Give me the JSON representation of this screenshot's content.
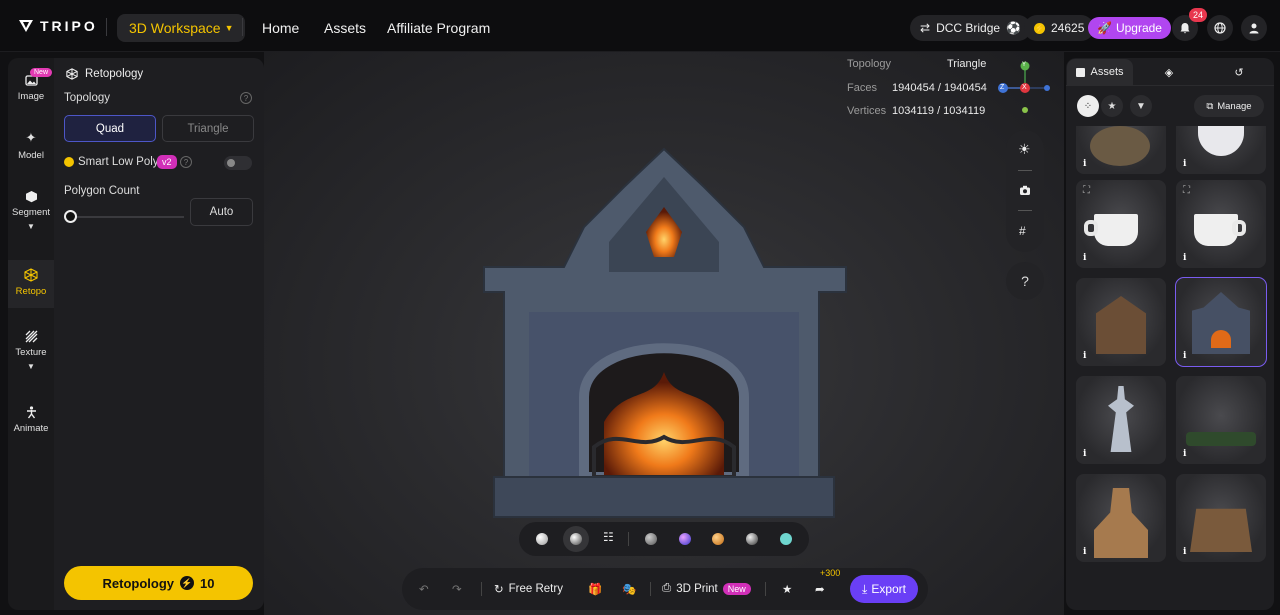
{
  "header": {
    "brand": "TRIPO",
    "workspace": "3D Workspace",
    "nav": [
      "Home",
      "Assets",
      "Affiliate Program"
    ],
    "dcc": "DCC Bridge",
    "credits": "24625",
    "upgrade": "Upgrade",
    "notifications": "24"
  },
  "rail": {
    "new_tag": "New",
    "items": [
      "Image",
      "Model",
      "Segment",
      "Retopo",
      "Texture",
      "Animate"
    ],
    "active": "Retopo"
  },
  "panel": {
    "title": "Retopology",
    "topology_label": "Topology",
    "quad": "Quad",
    "triangle": "Triangle",
    "smart_low_poly": "Smart Low Poly",
    "v2": "v2",
    "polygon_count": "Polygon Count",
    "auto": "Auto",
    "action_label": "Retopology",
    "action_cost": "10"
  },
  "viewport": {
    "topology_label": "Topology",
    "topology_value": "Triangle",
    "faces_label": "Faces",
    "faces_value": "1940454 / 1940454",
    "vertices_label": "Vertices",
    "vertices_value": "1034119 / 1034119",
    "axis_y": "Y",
    "axis_z": "Z",
    "axis_x": "X",
    "help": "?"
  },
  "bottombar": {
    "free_retry": "Free Retry",
    "print": "3D Print",
    "new": "New",
    "bonus": "+300",
    "export": "Export"
  },
  "assets_panel": {
    "tab_assets": "Assets",
    "manage": "Manage",
    "info_glyph": "i"
  },
  "colors": {
    "accent_yellow": "#f4c400",
    "accent_purple": "#6a3ff6",
    "upgrade_purple": "#b146f0",
    "badge_red": "#e8374e",
    "new_pink": "#d12fb8"
  }
}
